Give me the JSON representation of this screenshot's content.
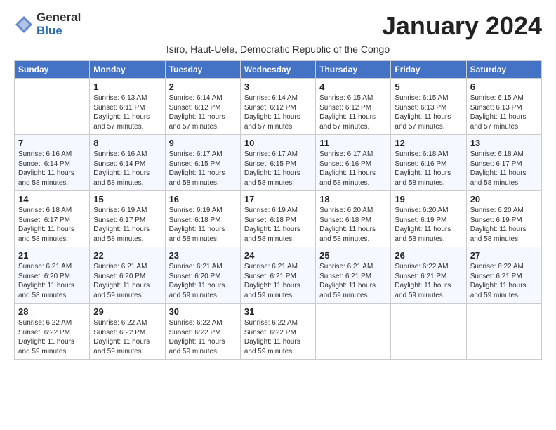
{
  "logo": {
    "general": "General",
    "blue": "Blue"
  },
  "title": "January 2024",
  "subtitle": "Isiro, Haut-Uele, Democratic Republic of the Congo",
  "days_of_week": [
    "Sunday",
    "Monday",
    "Tuesday",
    "Wednesday",
    "Thursday",
    "Friday",
    "Saturday"
  ],
  "weeks": [
    [
      {
        "day": null,
        "sunrise": null,
        "sunset": null,
        "daylight": null
      },
      {
        "day": "1",
        "sunrise": "Sunrise: 6:13 AM",
        "sunset": "Sunset: 6:11 PM",
        "daylight": "Daylight: 11 hours and 57 minutes."
      },
      {
        "day": "2",
        "sunrise": "Sunrise: 6:14 AM",
        "sunset": "Sunset: 6:12 PM",
        "daylight": "Daylight: 11 hours and 57 minutes."
      },
      {
        "day": "3",
        "sunrise": "Sunrise: 6:14 AM",
        "sunset": "Sunset: 6:12 PM",
        "daylight": "Daylight: 11 hours and 57 minutes."
      },
      {
        "day": "4",
        "sunrise": "Sunrise: 6:15 AM",
        "sunset": "Sunset: 6:12 PM",
        "daylight": "Daylight: 11 hours and 57 minutes."
      },
      {
        "day": "5",
        "sunrise": "Sunrise: 6:15 AM",
        "sunset": "Sunset: 6:13 PM",
        "daylight": "Daylight: 11 hours and 57 minutes."
      },
      {
        "day": "6",
        "sunrise": "Sunrise: 6:15 AM",
        "sunset": "Sunset: 6:13 PM",
        "daylight": "Daylight: 11 hours and 57 minutes."
      }
    ],
    [
      {
        "day": "7",
        "sunrise": "Sunrise: 6:16 AM",
        "sunset": "Sunset: 6:14 PM",
        "daylight": "Daylight: 11 hours and 58 minutes."
      },
      {
        "day": "8",
        "sunrise": "Sunrise: 6:16 AM",
        "sunset": "Sunset: 6:14 PM",
        "daylight": "Daylight: 11 hours and 58 minutes."
      },
      {
        "day": "9",
        "sunrise": "Sunrise: 6:17 AM",
        "sunset": "Sunset: 6:15 PM",
        "daylight": "Daylight: 11 hours and 58 minutes."
      },
      {
        "day": "10",
        "sunrise": "Sunrise: 6:17 AM",
        "sunset": "Sunset: 6:15 PM",
        "daylight": "Daylight: 11 hours and 58 minutes."
      },
      {
        "day": "11",
        "sunrise": "Sunrise: 6:17 AM",
        "sunset": "Sunset: 6:16 PM",
        "daylight": "Daylight: 11 hours and 58 minutes."
      },
      {
        "day": "12",
        "sunrise": "Sunrise: 6:18 AM",
        "sunset": "Sunset: 6:16 PM",
        "daylight": "Daylight: 11 hours and 58 minutes."
      },
      {
        "day": "13",
        "sunrise": "Sunrise: 6:18 AM",
        "sunset": "Sunset: 6:17 PM",
        "daylight": "Daylight: 11 hours and 58 minutes."
      }
    ],
    [
      {
        "day": "14",
        "sunrise": "Sunrise: 6:18 AM",
        "sunset": "Sunset: 6:17 PM",
        "daylight": "Daylight: 11 hours and 58 minutes."
      },
      {
        "day": "15",
        "sunrise": "Sunrise: 6:19 AM",
        "sunset": "Sunset: 6:17 PM",
        "daylight": "Daylight: 11 hours and 58 minutes."
      },
      {
        "day": "16",
        "sunrise": "Sunrise: 6:19 AM",
        "sunset": "Sunset: 6:18 PM",
        "daylight": "Daylight: 11 hours and 58 minutes."
      },
      {
        "day": "17",
        "sunrise": "Sunrise: 6:19 AM",
        "sunset": "Sunset: 6:18 PM",
        "daylight": "Daylight: 11 hours and 58 minutes."
      },
      {
        "day": "18",
        "sunrise": "Sunrise: 6:20 AM",
        "sunset": "Sunset: 6:18 PM",
        "daylight": "Daylight: 11 hours and 58 minutes."
      },
      {
        "day": "19",
        "sunrise": "Sunrise: 6:20 AM",
        "sunset": "Sunset: 6:19 PM",
        "daylight": "Daylight: 11 hours and 58 minutes."
      },
      {
        "day": "20",
        "sunrise": "Sunrise: 6:20 AM",
        "sunset": "Sunset: 6:19 PM",
        "daylight": "Daylight: 11 hours and 58 minutes."
      }
    ],
    [
      {
        "day": "21",
        "sunrise": "Sunrise: 6:21 AM",
        "sunset": "Sunset: 6:20 PM",
        "daylight": "Daylight: 11 hours and 58 minutes."
      },
      {
        "day": "22",
        "sunrise": "Sunrise: 6:21 AM",
        "sunset": "Sunset: 6:20 PM",
        "daylight": "Daylight: 11 hours and 59 minutes."
      },
      {
        "day": "23",
        "sunrise": "Sunrise: 6:21 AM",
        "sunset": "Sunset: 6:20 PM",
        "daylight": "Daylight: 11 hours and 59 minutes."
      },
      {
        "day": "24",
        "sunrise": "Sunrise: 6:21 AM",
        "sunset": "Sunset: 6:21 PM",
        "daylight": "Daylight: 11 hours and 59 minutes."
      },
      {
        "day": "25",
        "sunrise": "Sunrise: 6:21 AM",
        "sunset": "Sunset: 6:21 PM",
        "daylight": "Daylight: 11 hours and 59 minutes."
      },
      {
        "day": "26",
        "sunrise": "Sunrise: 6:22 AM",
        "sunset": "Sunset: 6:21 PM",
        "daylight": "Daylight: 11 hours and 59 minutes."
      },
      {
        "day": "27",
        "sunrise": "Sunrise: 6:22 AM",
        "sunset": "Sunset: 6:21 PM",
        "daylight": "Daylight: 11 hours and 59 minutes."
      }
    ],
    [
      {
        "day": "28",
        "sunrise": "Sunrise: 6:22 AM",
        "sunset": "Sunset: 6:22 PM",
        "daylight": "Daylight: 11 hours and 59 minutes."
      },
      {
        "day": "29",
        "sunrise": "Sunrise: 6:22 AM",
        "sunset": "Sunset: 6:22 PM",
        "daylight": "Daylight: 11 hours and 59 minutes."
      },
      {
        "day": "30",
        "sunrise": "Sunrise: 6:22 AM",
        "sunset": "Sunset: 6:22 PM",
        "daylight": "Daylight: 11 hours and 59 minutes."
      },
      {
        "day": "31",
        "sunrise": "Sunrise: 6:22 AM",
        "sunset": "Sunset: 6:22 PM",
        "daylight": "Daylight: 11 hours and 59 minutes."
      },
      {
        "day": null,
        "sunrise": null,
        "sunset": null,
        "daylight": null
      },
      {
        "day": null,
        "sunrise": null,
        "sunset": null,
        "daylight": null
      },
      {
        "day": null,
        "sunrise": null,
        "sunset": null,
        "daylight": null
      }
    ]
  ]
}
